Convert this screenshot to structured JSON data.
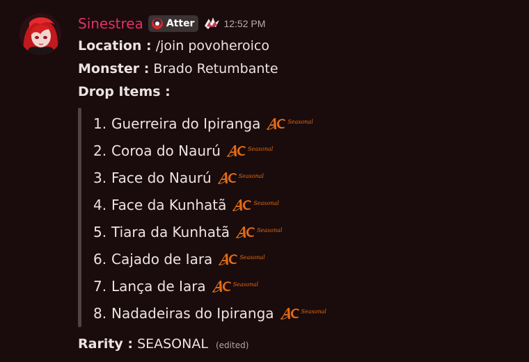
{
  "message": {
    "avatar_icon": "avatar-red-haired-girl",
    "username": "Sinestrea",
    "tag_label": "Atter",
    "tag_icon": "crescent-logo-icon",
    "role_icon": "shattered-wing-icon",
    "timestamp": "12:52 PM",
    "location_label": "Location :",
    "location_value": "/join povoheroico",
    "monster_label": "Monster :",
    "monster_value": "Brado Retumbante",
    "drop_label": "Drop Items :",
    "drop_items": [
      {
        "num": "1.",
        "name": "Guerreira do Ipiranga",
        "badge": "AC",
        "badge_tag": "Seasonal"
      },
      {
        "num": "2.",
        "name": "Coroa do Naurú",
        "badge": "AC",
        "badge_tag": "Seasonal"
      },
      {
        "num": "3.",
        "name": "Face do Naurú",
        "badge": "AC",
        "badge_tag": "Seasonal"
      },
      {
        "num": "4.",
        "name": "Face da Kunhatã",
        "badge": "AC",
        "badge_tag": "Seasonal"
      },
      {
        "num": "5.",
        "name": "Tiara da Kunhatã",
        "badge": "AC",
        "badge_tag": "Seasonal"
      },
      {
        "num": "6.",
        "name": "Cajado de Iara",
        "badge": "AC",
        "badge_tag": "Seasonal"
      },
      {
        "num": "7.",
        "name": "Lança de Iara",
        "badge": "AC",
        "badge_tag": "Seasonal"
      },
      {
        "num": "8.",
        "name": "Nadadeiras do Ipiranga",
        "badge": "AC",
        "badge_tag": "Seasonal"
      }
    ],
    "rarity_label": "Rarity :",
    "rarity_value": "SEASONAL",
    "edited_label": "(edited)"
  },
  "colors": {
    "background": "#1a0b0c",
    "username": "#e2306a",
    "badge": "#e06a15",
    "quote_bar": "#4e4446"
  }
}
